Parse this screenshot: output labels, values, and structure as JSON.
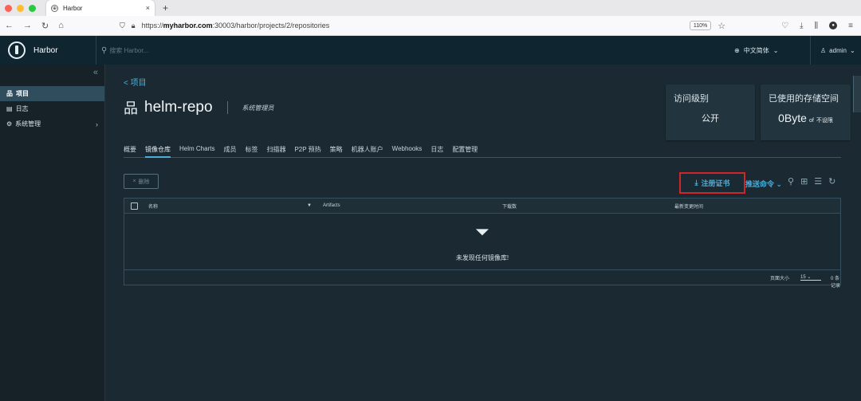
{
  "browser": {
    "tab_title": "Harbor",
    "tab_close": "×",
    "new_tab": "+",
    "url_prefix": "https://",
    "url_host": "myharbor.com",
    "url_rest": ":30003/harbor/projects/2/repositories",
    "zoom": "110%"
  },
  "header": {
    "brand": "Harbor",
    "search_placeholder": "搜索 Harbor...",
    "language": "中文简体",
    "user": "admin"
  },
  "sidebar": {
    "collapse": "«",
    "items": [
      {
        "label": "项目"
      },
      {
        "label": "日志"
      },
      {
        "label": "系统管理"
      }
    ]
  },
  "main": {
    "back": "< 项目",
    "repo_name": "helm-repo",
    "role": "系统管理员",
    "card_access": {
      "title": "访问级别",
      "value": "公开"
    },
    "card_storage": {
      "title": "已使用的存储空间",
      "value_big": "0Byte",
      "value_of": "of",
      "value_limit": "不设限"
    },
    "tabs": [
      "概要",
      "镜像仓库",
      "Helm Charts",
      "成员",
      "标签",
      "扫描器",
      "P2P 预热",
      "策略",
      "机器人账户",
      "Webhooks",
      "日志",
      "配置管理"
    ],
    "delete_label": "删除",
    "cert_label": "注册证书",
    "push_label": "推送命令",
    "columns": {
      "name": "名称",
      "artifacts": "Artifacts",
      "pulls": "下载数",
      "updated": "最新变更时间"
    },
    "empty": "未发现任何镜像库!",
    "footer": {
      "page_size_label": "页面大小",
      "page_size": "15",
      "count": "0 条记录"
    }
  }
}
